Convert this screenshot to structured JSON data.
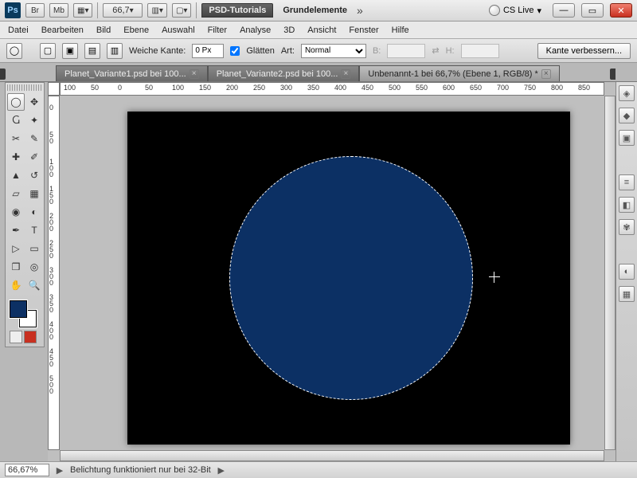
{
  "title": {
    "psd_tab": "PSD-Tutorials",
    "group": "Grundelemente",
    "cslive": "CS Live",
    "zoom_combo": "66,7"
  },
  "menu": [
    "Datei",
    "Bearbeiten",
    "Bild",
    "Ebene",
    "Auswahl",
    "Filter",
    "Analyse",
    "3D",
    "Ansicht",
    "Fenster",
    "Hilfe"
  ],
  "options": {
    "weiche_label": "Weiche Kante:",
    "weiche_value": "0 Px",
    "glatt_label": "Glätten",
    "art_label": "Art:",
    "art_value": "Normal",
    "b_label": "B:",
    "h_label": "H:",
    "refine": "Kante verbessern..."
  },
  "tabs": [
    {
      "label": "Planet_Variante1.psd bei 100...",
      "active": false
    },
    {
      "label": "Planet_Variante2.psd bei 100...",
      "active": false
    },
    {
      "label": "Unbenannt-1 bei 66,7% (Ebene 1, RGB/8) *",
      "active": true
    }
  ],
  "hruler_nums": [
    "100",
    "50",
    "0",
    "50",
    "100",
    "150",
    "200",
    "250",
    "300",
    "350",
    "400",
    "450",
    "500",
    "550",
    "600",
    "650",
    "700",
    "750",
    "800",
    "850"
  ],
  "vruler_nums": [
    "0",
    "50",
    "100",
    "150",
    "200",
    "250",
    "300",
    "350",
    "400",
    "450",
    "500"
  ],
  "status": {
    "zoom": "66,67%",
    "msg": "Belichtung funktioniert nur bei 32-Bit"
  },
  "colors": {
    "fg": "#0c3064",
    "bg": "#ffffff",
    "canvas": "#000000",
    "circle": "#0c3064"
  },
  "chart_data": {
    "type": "table",
    "note": "image editor UI; no chart data"
  }
}
